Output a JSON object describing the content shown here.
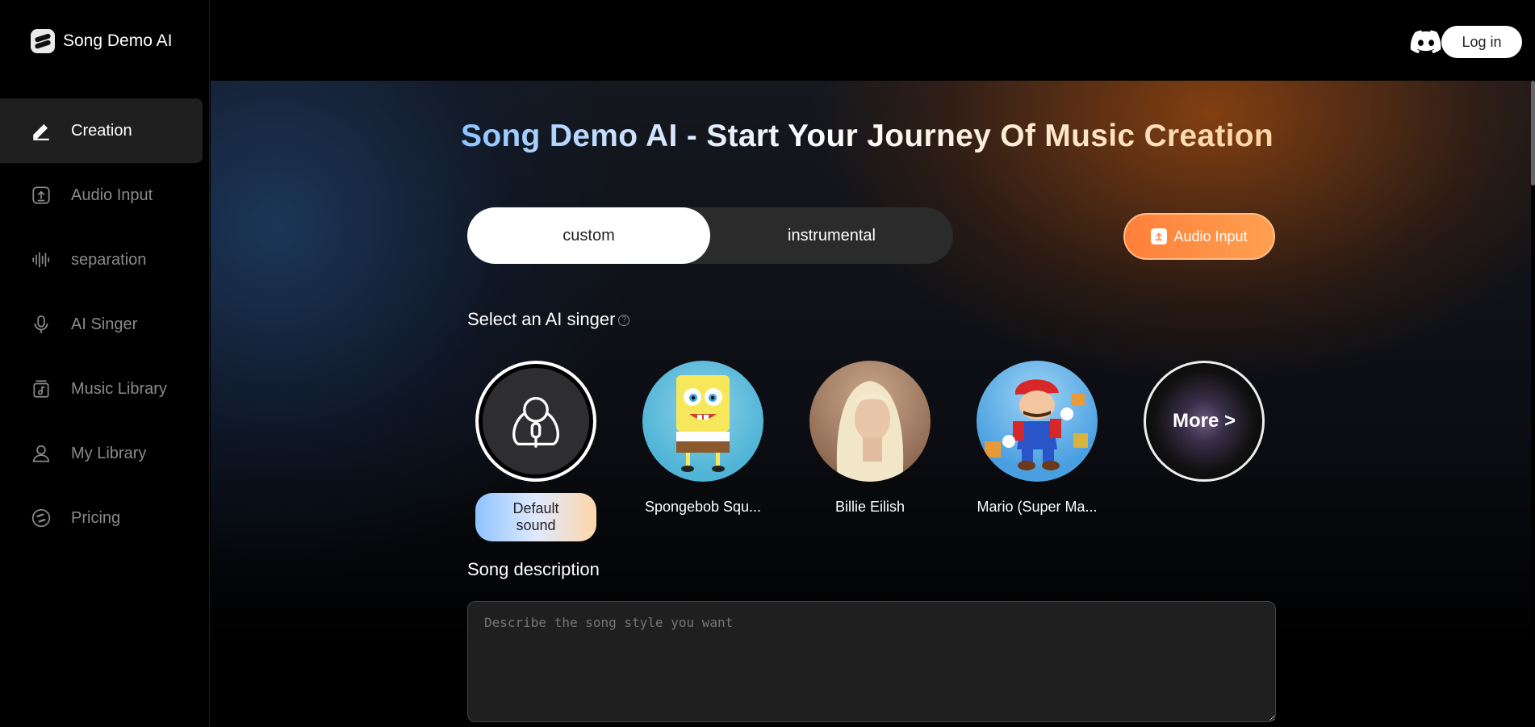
{
  "brand": {
    "name": "Song Demo AI"
  },
  "sidebar": {
    "items": [
      {
        "label": "Creation",
        "icon": "pencil-icon",
        "active": true
      },
      {
        "label": "Audio Input",
        "icon": "upload-icon",
        "active": false
      },
      {
        "label": "separation",
        "icon": "waveform-icon",
        "active": false
      },
      {
        "label": "AI Singer",
        "icon": "microphone-icon",
        "active": false
      },
      {
        "label": "Music Library",
        "icon": "music-library-icon",
        "active": false
      },
      {
        "label": "My Library",
        "icon": "user-icon",
        "active": false
      },
      {
        "label": "Pricing",
        "icon": "coin-icon",
        "active": false
      }
    ]
  },
  "topbar": {
    "login_label": "Log in",
    "discord_icon": "discord-icon"
  },
  "main": {
    "title": "Song Demo AI - Start Your Journey Of Music Creation",
    "modes": [
      {
        "label": "custom",
        "active": true
      },
      {
        "label": "instrumental",
        "active": false
      }
    ],
    "audio_input_label": "Audio Input",
    "select_singer_label": "Select an AI singer",
    "singers": [
      {
        "name": "Default sound",
        "selected": true
      },
      {
        "name": "Spongebob Squ..."
      },
      {
        "name": "Billie Eilish"
      },
      {
        "name": "Mario (Super Ma..."
      },
      {
        "name": "More >"
      }
    ],
    "song_description_label": "Song description",
    "description_placeholder": "Describe the song style you want"
  },
  "colors": {
    "accent_orange": "#ff8a3d",
    "active_nav_bg": "#1f1f1f"
  }
}
